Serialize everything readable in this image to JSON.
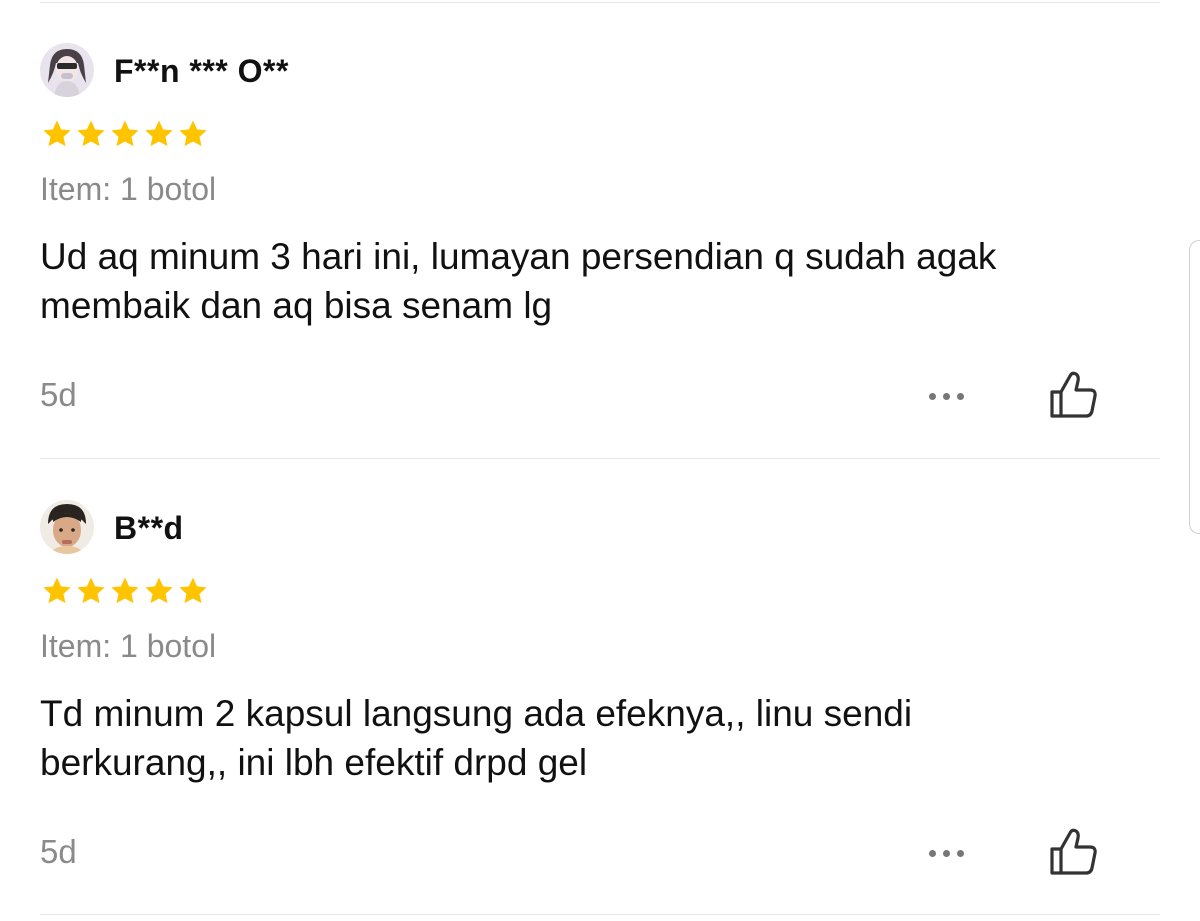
{
  "reviews": [
    {
      "username": "F**n *** O**",
      "rating": 5,
      "item_variant": "Item: 1 botol",
      "text": "Ud aq minum 3 hari ini, lumayan persendian q sudah agak membaik dan aq bisa senam lg",
      "timestamp": "5d",
      "star_color": "#FFC400",
      "avatar_icon": "avatar-photo-icon"
    },
    {
      "username": "B**d",
      "rating": 5,
      "item_variant": "Item: 1 botol",
      "text": "Td minum 2 kapsul langsung ada efeknya,, linu sendi berkurang,, ini lbh efektif drpd gel",
      "timestamp": "5d",
      "star_color": "#FFC400",
      "avatar_icon": "avatar-photo-icon"
    }
  ],
  "actions": {
    "more_icon": "more-horizontal-icon",
    "like_icon": "thumbs-up-icon"
  },
  "colors": {
    "star": "#FFC400",
    "muted_text": "#8A8A8A",
    "divider": "#E6E6E6"
  }
}
